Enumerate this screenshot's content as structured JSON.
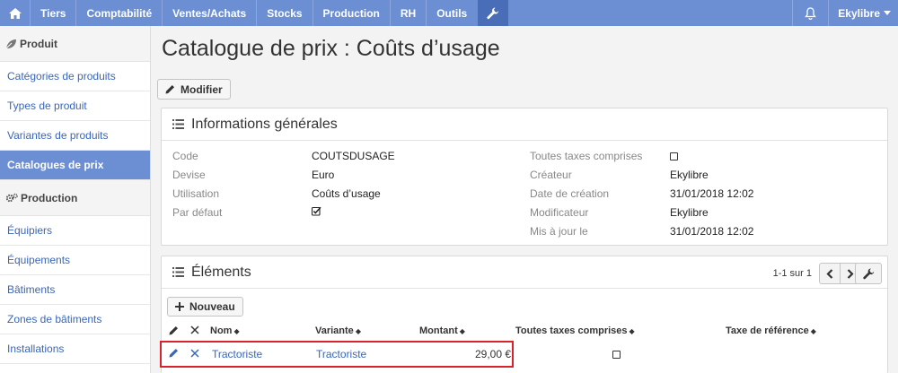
{
  "topnav": {
    "items": [
      "Tiers",
      "Comptabilité",
      "Ventes/Achats",
      "Stocks",
      "Production",
      "RH",
      "Outils"
    ],
    "user": "Ekylibre",
    "brand_color": "#6c8fd4"
  },
  "sidebar": {
    "sections": [
      {
        "title": "Produit",
        "items": [
          "Catégories de produits",
          "Types de produit",
          "Variantes de produits",
          "Catalogues de prix"
        ]
      },
      {
        "title": "Production",
        "items": [
          "Équipiers",
          "Équipements",
          "Bâtiments",
          "Zones de bâtiments",
          "Installations"
        ]
      }
    ],
    "active": "Catalogues de prix"
  },
  "page": {
    "title": "Catalogue de prix : Coûts d’usage",
    "modify_label": "Modifier"
  },
  "info": {
    "title": "Informations générales",
    "left": [
      {
        "label": "Code",
        "value": "COUTSDUSAGE"
      },
      {
        "label": "Devise",
        "value": "Euro"
      },
      {
        "label": "Utilisation",
        "value": "Coûts d’usage"
      },
      {
        "label": "Par défaut",
        "value": ""
      }
    ],
    "right": [
      {
        "label": "Toutes taxes comprises",
        "value": ""
      },
      {
        "label": "Créateur",
        "value": "Ekylibre"
      },
      {
        "label": "Date de création",
        "value": "31/01/2018 12:02"
      },
      {
        "label": "Modificateur",
        "value": "Ekylibre"
      },
      {
        "label": "Mis à jour le",
        "value": "31/01/2018 12:02"
      }
    ],
    "par_defaut_checked": true,
    "ttc_checked": false
  },
  "elements": {
    "title": "Éléments",
    "pagination": "1-1 sur 1",
    "new_label": "Nouveau",
    "columns": [
      "Nom",
      "Variante",
      "Montant",
      "Toutes taxes comprises",
      "Taxe de référence"
    ],
    "rows": [
      {
        "nom": "Tractoriste",
        "variante": "Tractoriste",
        "montant": "29,00 €",
        "ttc": false,
        "taxe": ""
      }
    ],
    "highlight_color": "#d8232a"
  }
}
